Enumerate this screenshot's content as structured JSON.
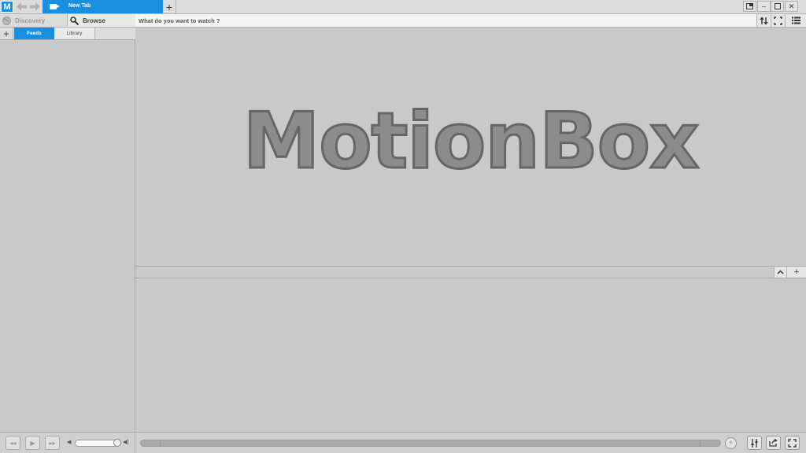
{
  "app": {
    "logo_letter": "M",
    "brand_color": "#1a8fe0",
    "tab_label": "New Tab",
    "new_tab_icon": "plus-icon"
  },
  "window_controls": [
    "restore-icon",
    "minimize-icon",
    "maximize-icon",
    "close-icon"
  ],
  "sidebar": {
    "nav": [
      {
        "label": "Discovery",
        "icon": "globe-icon"
      },
      {
        "label": "Browse",
        "icon": "search-icon"
      }
    ],
    "subtabs": [
      {
        "label": "Feeds",
        "active": true
      },
      {
        "label": "Library",
        "active": false
      }
    ]
  },
  "search": {
    "placeholder": "What do you want to watch ?"
  },
  "main": {
    "title": "MotionBox"
  }
}
